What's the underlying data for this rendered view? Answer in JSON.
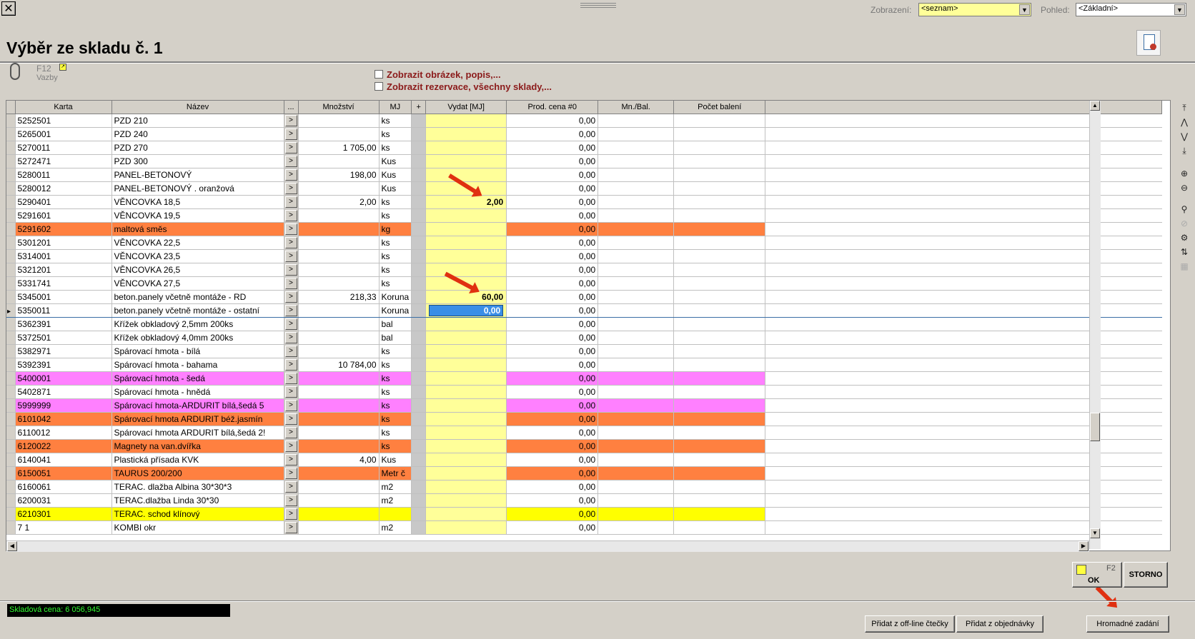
{
  "top": {
    "zobrazeni_label": "Zobrazení:",
    "zobrazeni_value": "<seznam>",
    "pohled_label": "Pohled:",
    "pohled_value": "<Základní>"
  },
  "title": "Výběr ze skladu č. 1",
  "vazby": {
    "key": "F12",
    "label": "Vazby"
  },
  "options": {
    "show_image": "Zobrazit obrázek, popis,...",
    "show_reservation": "Zobrazit rezervace, všechny sklady,..."
  },
  "grid": {
    "columns": {
      "karta": "Karta",
      "nazev": "Název",
      "dots": "...",
      "mnozstvi": "Množství",
      "mj": "MJ",
      "plus": "+",
      "vydat": "Vydat [MJ]",
      "prod_cena": "Prod. cena #0",
      "mn_bal": "Mn./Bal.",
      "pocet_baleni": "Počet balení"
    },
    "button_glyph": ">",
    "rows": [
      {
        "karta": "5252501",
        "nazev": "PZD 210",
        "mnozstvi": "",
        "mj": "ks",
        "vydat": "",
        "cena": "0,00",
        "color": "#ffffff"
      },
      {
        "karta": "5265001",
        "nazev": "PZD 240",
        "mnozstvi": "",
        "mj": "ks",
        "vydat": "",
        "cena": "0,00",
        "color": "#ffffff"
      },
      {
        "karta": "5270011",
        "nazev": "PZD 270",
        "mnozstvi": "1 705,00",
        "mj": "ks",
        "vydat": "",
        "cena": "0,00",
        "color": "#ffffff"
      },
      {
        "karta": "5272471",
        "nazev": "PZD 300",
        "mnozstvi": "",
        "mj": "Kus",
        "vydat": "",
        "cena": "0,00",
        "color": "#ffffff"
      },
      {
        "karta": "5280011",
        "nazev": "PANEL-BETONOVÝ",
        "mnozstvi": "198,00",
        "mj": "Kus",
        "vydat": "",
        "cena": "0,00",
        "color": "#ffffff"
      },
      {
        "karta": "5280012",
        "nazev": "PANEL-BETONOVÝ . oranžová",
        "mnozstvi": "",
        "mj": "Kus",
        "vydat": "",
        "cena": "0,00",
        "color": "#ffffff"
      },
      {
        "karta": "5290401",
        "nazev": "VĚNCOVKA 18,5",
        "mnozstvi": "2,00",
        "mj": "ks",
        "vydat": "2,00",
        "cena": "0,00",
        "color": "#ffffff"
      },
      {
        "karta": "5291601",
        "nazev": "VĚNCOVKA 19,5",
        "mnozstvi": "",
        "mj": "ks",
        "vydat": "",
        "cena": "0,00",
        "color": "#ffffff"
      },
      {
        "karta": "5291602",
        "nazev": "maltová směs",
        "mnozstvi": "",
        "mj": "kg",
        "vydat": "",
        "cena": "0,00",
        "color": "#ff8040"
      },
      {
        "karta": "5301201",
        "nazev": "VĚNCOVKA 22,5",
        "mnozstvi": "",
        "mj": "ks",
        "vydat": "",
        "cena": "0,00",
        "color": "#ffffff"
      },
      {
        "karta": "5314001",
        "nazev": "VĚNCOVKA 23,5",
        "mnozstvi": "",
        "mj": "ks",
        "vydat": "",
        "cena": "0,00",
        "color": "#ffffff"
      },
      {
        "karta": "5321201",
        "nazev": "VĚNCOVKA 26,5",
        "mnozstvi": "",
        "mj": "ks",
        "vydat": "",
        "cena": "0,00",
        "color": "#ffffff"
      },
      {
        "karta": "5331741",
        "nazev": "VĚNCOVKA 27,5",
        "mnozstvi": "",
        "mj": "ks",
        "vydat": "",
        "cena": "0,00",
        "color": "#ffffff"
      },
      {
        "karta": "5345001",
        "nazev": "beton.panely včetně montáže - RD",
        "mnozstvi": "218,33",
        "mj": "Koruna",
        "vydat": "60,00",
        "cena": "0,00",
        "color": "#ffffff"
      },
      {
        "karta": "5350011",
        "nazev": "beton.panely včetně montáže - ostatní",
        "mnozstvi": "",
        "mj": "Koruna",
        "vydat": "0,00",
        "cena": "0,00",
        "color": "#ffffff",
        "selected": true
      },
      {
        "karta": "5362391",
        "nazev": "Křížek obkladový 2,5mm  200ks",
        "mnozstvi": "",
        "mj": "bal",
        "vydat": "",
        "cena": "0,00",
        "color": "#ffffff"
      },
      {
        "karta": "5372501",
        "nazev": "Křížek obkladový 4,0mm  200ks",
        "mnozstvi": "",
        "mj": "bal",
        "vydat": "",
        "cena": "0,00",
        "color": "#ffffff"
      },
      {
        "karta": "5382971",
        "nazev": "Spárovací hmota - bílá",
        "mnozstvi": "",
        "mj": "ks",
        "vydat": "",
        "cena": "0,00",
        "color": "#ffffff"
      },
      {
        "karta": "5392391",
        "nazev": "Spárovací hmota - bahama",
        "mnozstvi": "10 784,00",
        "mj": "ks",
        "vydat": "",
        "cena": "0,00",
        "color": "#ffffff"
      },
      {
        "karta": "5400001",
        "nazev": "Spárovací hmota - šedá",
        "mnozstvi": "",
        "mj": "ks",
        "vydat": "",
        "cena": "0,00",
        "color": "#ff80ff"
      },
      {
        "karta": "5402871",
        "nazev": "Spárovací hmota - hnědá",
        "mnozstvi": "",
        "mj": "ks",
        "vydat": "",
        "cena": "0,00",
        "color": "#ffffff"
      },
      {
        "karta": "5999999",
        "nazev": "Spárovací hmota-ARDURIT bílá,šedá 5",
        "mnozstvi": "",
        "mj": "ks",
        "vydat": "",
        "cena": "0,00",
        "color": "#ff80ff"
      },
      {
        "karta": "6101042",
        "nazev": "Spárovací hmota ARDURIT béž.jasmín",
        "mnozstvi": "",
        "mj": "ks",
        "vydat": "",
        "cena": "0,00",
        "color": "#ff8040"
      },
      {
        "karta": "6110012",
        "nazev": "Spárovací hmota ARDURIT bílá,šedá 2!",
        "mnozstvi": "",
        "mj": "ks",
        "vydat": "",
        "cena": "0,00",
        "color": "#ffffff"
      },
      {
        "karta": "6120022",
        "nazev": "Magnety na van.dvířka",
        "mnozstvi": "",
        "mj": "ks",
        "vydat": "",
        "cena": "0,00",
        "color": "#ff8040"
      },
      {
        "karta": "6140041",
        "nazev": "Plastická přísada KVK",
        "mnozstvi": "4,00",
        "mj": "Kus",
        "vydat": "",
        "cena": "0,00",
        "color": "#ffffff"
      },
      {
        "karta": "6150051",
        "nazev": "TAURUS 200/200",
        "mnozstvi": "",
        "mj": "Metr č",
        "vydat": "",
        "cena": "0,00",
        "color": "#ff8040"
      },
      {
        "karta": "6160061",
        "nazev": "TERAC. dlažba Albina 30*30*3",
        "mnozstvi": "",
        "mj": "m2",
        "vydat": "",
        "cena": "0,00",
        "color": "#ffffff"
      },
      {
        "karta": "6200031",
        "nazev": "TERAC.dlažba Linda 30*30",
        "mnozstvi": "",
        "mj": "m2",
        "vydat": "",
        "cena": "0,00",
        "color": "#ffffff"
      },
      {
        "karta": "6210301",
        "nazev": "TERAC. schod klínový",
        "mnozstvi": "",
        "mj": "",
        "vydat": "",
        "cena": "0,00",
        "color": "#ffff00"
      },
      {
        "karta": "7    1",
        "nazev": "KOMBI okr",
        "mnozstvi": "",
        "mj": "m2",
        "vydat": "",
        "cena": "0,00",
        "color": "#ffffff"
      }
    ]
  },
  "buttons": {
    "ok_key": "F2",
    "ok": "OK",
    "storno": "STORNO",
    "offline": "Přidat z off-line čtečky",
    "objednavky": "Přidat z objednávky",
    "hromadne": "Hromadné zadání"
  },
  "status": "Skladová cena: 6 056,945",
  "colors": {
    "selected_edit": "#3a8ee6",
    "vydat_bg": "#ffff99",
    "arrow": "#e03010"
  }
}
